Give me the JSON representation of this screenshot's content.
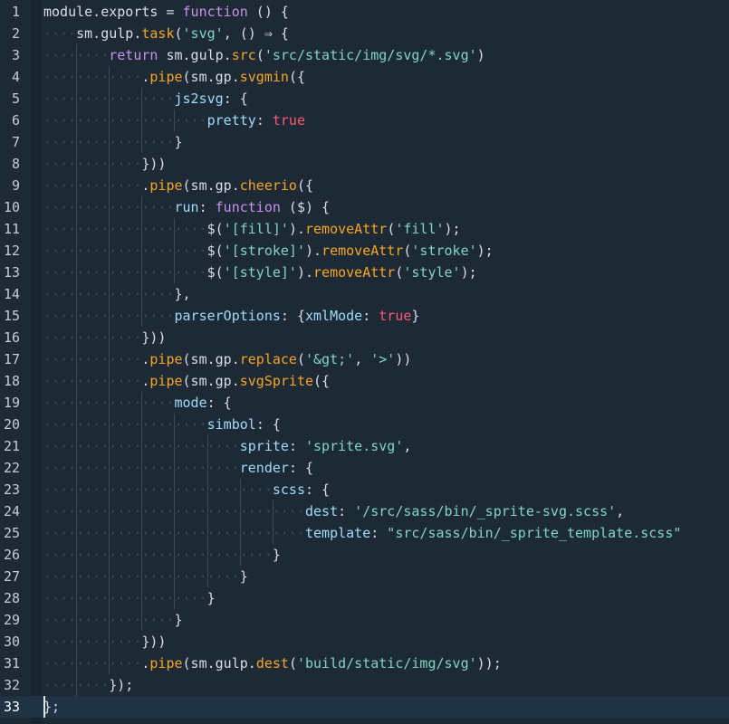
{
  "editor": {
    "lines": [
      {
        "n": "1",
        "indent": 0,
        "tokens": [
          [
            "plain",
            "module.exports = "
          ],
          [
            "kw",
            "function"
          ],
          [
            "plain",
            " () {"
          ]
        ]
      },
      {
        "n": "2",
        "indent": 1,
        "tokens": [
          [
            "plain",
            "sm.gulp."
          ],
          [
            "fn",
            "task"
          ],
          [
            "plain",
            "("
          ],
          [
            "str",
            "'svg'"
          ],
          [
            "plain",
            ", () ⇒ {"
          ]
        ]
      },
      {
        "n": "3",
        "indent": 2,
        "tokens": [
          [
            "kw",
            "return"
          ],
          [
            "plain",
            " sm.gulp."
          ],
          [
            "fn",
            "src"
          ],
          [
            "plain",
            "("
          ],
          [
            "str",
            "'src/static/img/svg/*.svg'"
          ],
          [
            "plain",
            ")"
          ]
        ]
      },
      {
        "n": "4",
        "indent": 3,
        "tokens": [
          [
            "plain",
            "."
          ],
          [
            "fn",
            "pipe"
          ],
          [
            "plain",
            "(sm.gp."
          ],
          [
            "fn",
            "svgmin"
          ],
          [
            "plain",
            "({"
          ]
        ]
      },
      {
        "n": "5",
        "indent": 4,
        "tokens": [
          [
            "key",
            "js2svg"
          ],
          [
            "plain",
            ": {"
          ]
        ]
      },
      {
        "n": "6",
        "indent": 5,
        "tokens": [
          [
            "key",
            "pretty"
          ],
          [
            "plain",
            ": "
          ],
          [
            "bool",
            "true"
          ]
        ]
      },
      {
        "n": "7",
        "indent": 4,
        "tokens": [
          [
            "plain",
            "}"
          ]
        ]
      },
      {
        "n": "8",
        "indent": 3,
        "tokens": [
          [
            "plain",
            "}))"
          ]
        ]
      },
      {
        "n": "9",
        "indent": 3,
        "tokens": [
          [
            "plain",
            "."
          ],
          [
            "fn",
            "pipe"
          ],
          [
            "plain",
            "(sm.gp."
          ],
          [
            "fn",
            "cheerio"
          ],
          [
            "plain",
            "({"
          ]
        ]
      },
      {
        "n": "10",
        "indent": 4,
        "tokens": [
          [
            "key",
            "run"
          ],
          [
            "plain",
            ": "
          ],
          [
            "kw",
            "function"
          ],
          [
            "plain",
            " ($) {"
          ]
        ]
      },
      {
        "n": "11",
        "indent": 5,
        "tokens": [
          [
            "plain",
            "$("
          ],
          [
            "str",
            "'[fill]'"
          ],
          [
            "plain",
            ")."
          ],
          [
            "fn",
            "removeAttr"
          ],
          [
            "plain",
            "("
          ],
          [
            "str",
            "'fill'"
          ],
          [
            "plain",
            ");"
          ]
        ]
      },
      {
        "n": "12",
        "indent": 5,
        "tokens": [
          [
            "plain",
            "$("
          ],
          [
            "str",
            "'[stroke]'"
          ],
          [
            "plain",
            ")."
          ],
          [
            "fn",
            "removeAttr"
          ],
          [
            "plain",
            "("
          ],
          [
            "str",
            "'stroke'"
          ],
          [
            "plain",
            ");"
          ]
        ]
      },
      {
        "n": "13",
        "indent": 5,
        "tokens": [
          [
            "plain",
            "$("
          ],
          [
            "str",
            "'[style]'"
          ],
          [
            "plain",
            ")."
          ],
          [
            "fn",
            "removeAttr"
          ],
          [
            "plain",
            "("
          ],
          [
            "str",
            "'style'"
          ],
          [
            "plain",
            ");"
          ]
        ]
      },
      {
        "n": "14",
        "indent": 4,
        "tokens": [
          [
            "plain",
            "},"
          ]
        ]
      },
      {
        "n": "15",
        "indent": 4,
        "tokens": [
          [
            "key",
            "parserOptions"
          ],
          [
            "plain",
            ": {"
          ],
          [
            "key",
            "xmlMode"
          ],
          [
            "plain",
            ": "
          ],
          [
            "bool",
            "true"
          ],
          [
            "plain",
            "}"
          ]
        ]
      },
      {
        "n": "16",
        "indent": 3,
        "tokens": [
          [
            "plain",
            "}))"
          ]
        ]
      },
      {
        "n": "17",
        "indent": 3,
        "tokens": [
          [
            "plain",
            "."
          ],
          [
            "fn",
            "pipe"
          ],
          [
            "plain",
            "(sm.gp."
          ],
          [
            "fn",
            "replace"
          ],
          [
            "plain",
            "("
          ],
          [
            "str",
            "'&gt;'"
          ],
          [
            "plain",
            ", "
          ],
          [
            "str",
            "'>'"
          ],
          [
            "plain",
            "))"
          ]
        ]
      },
      {
        "n": "18",
        "indent": 3,
        "tokens": [
          [
            "plain",
            "."
          ],
          [
            "fn",
            "pipe"
          ],
          [
            "plain",
            "(sm.gp."
          ],
          [
            "fn",
            "svgSprite"
          ],
          [
            "plain",
            "({"
          ]
        ]
      },
      {
        "n": "19",
        "indent": 4,
        "tokens": [
          [
            "key",
            "mode"
          ],
          [
            "plain",
            ": {"
          ]
        ]
      },
      {
        "n": "20",
        "indent": 5,
        "tokens": [
          [
            "key",
            "simbol"
          ],
          [
            "plain",
            ": {"
          ]
        ]
      },
      {
        "n": "21",
        "indent": 6,
        "tokens": [
          [
            "key",
            "sprite"
          ],
          [
            "plain",
            ": "
          ],
          [
            "str",
            "'sprite.svg'"
          ],
          [
            "plain",
            ","
          ]
        ]
      },
      {
        "n": "22",
        "indent": 6,
        "tokens": [
          [
            "key",
            "render"
          ],
          [
            "plain",
            ": {"
          ]
        ]
      },
      {
        "n": "23",
        "indent": 7,
        "tokens": [
          [
            "key",
            "scss"
          ],
          [
            "plain",
            ": {"
          ]
        ]
      },
      {
        "n": "24",
        "indent": 8,
        "tokens": [
          [
            "key",
            "dest"
          ],
          [
            "plain",
            ": "
          ],
          [
            "str",
            "'/src/sass/bin/_sprite-svg.scss'"
          ],
          [
            "plain",
            ","
          ]
        ]
      },
      {
        "n": "25",
        "indent": 8,
        "tokens": [
          [
            "key",
            "template"
          ],
          [
            "plain",
            ": "
          ],
          [
            "str",
            "\"src/sass/bin/_sprite_template.scss\""
          ]
        ]
      },
      {
        "n": "26",
        "indent": 7,
        "tokens": [
          [
            "plain",
            "}"
          ]
        ]
      },
      {
        "n": "27",
        "indent": 6,
        "tokens": [
          [
            "plain",
            "}"
          ]
        ]
      },
      {
        "n": "28",
        "indent": 5,
        "tokens": [
          [
            "plain",
            "}"
          ]
        ]
      },
      {
        "n": "29",
        "indent": 4,
        "tokens": [
          [
            "plain",
            "}"
          ]
        ]
      },
      {
        "n": "30",
        "indent": 3,
        "tokens": [
          [
            "plain",
            "}))"
          ]
        ]
      },
      {
        "n": "31",
        "indent": 3,
        "tokens": [
          [
            "plain",
            "."
          ],
          [
            "fn",
            "pipe"
          ],
          [
            "plain",
            "(sm.gulp."
          ],
          [
            "fn",
            "dest"
          ],
          [
            "plain",
            "("
          ],
          [
            "str",
            "'build/static/img/svg'"
          ],
          [
            "plain",
            "));"
          ]
        ]
      },
      {
        "n": "32",
        "indent": 2,
        "tokens": [
          [
            "plain",
            "});"
          ]
        ]
      },
      {
        "n": "33",
        "indent": 0,
        "tokens": [
          [
            "plain",
            "};"
          ]
        ]
      }
    ],
    "current_line": "33"
  }
}
